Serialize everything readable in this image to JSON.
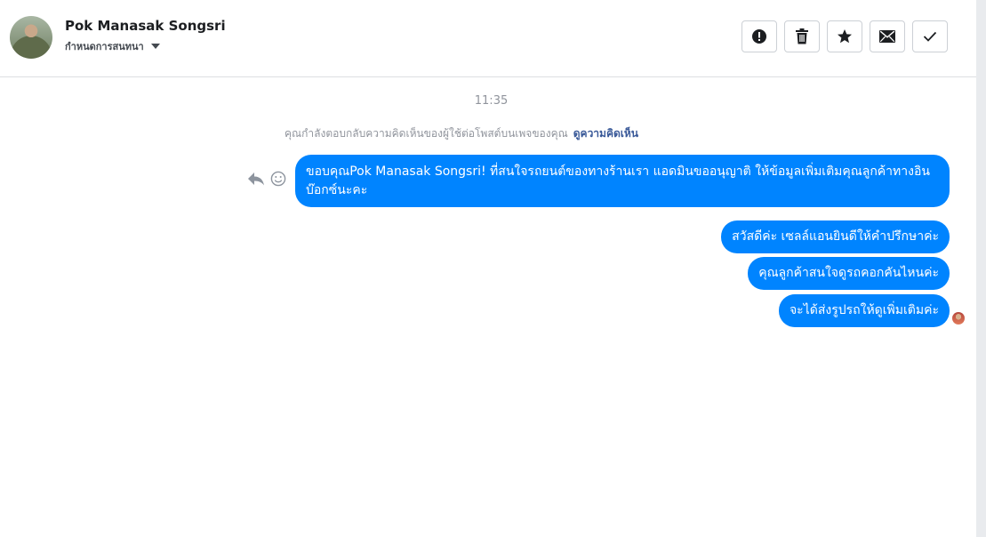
{
  "header": {
    "contact_name": "Pok Manasak Songsri",
    "assign_label": "กำหนดการสนทนา",
    "avatar_icon": "user-avatar",
    "toolbar": [
      {
        "name": "mark-spam-button",
        "icon": "exclamation-icon"
      },
      {
        "name": "delete-button",
        "icon": "trash-icon"
      },
      {
        "name": "star-button",
        "icon": "star-icon"
      },
      {
        "name": "mark-unread-button",
        "icon": "envelope-icon"
      },
      {
        "name": "mark-done-button",
        "icon": "checkmark-icon"
      }
    ]
  },
  "conversation": {
    "timestamp": "11:35",
    "context_text": "คุณกำลังตอบกลับความคิดเห็นของผู้ใช้ต่อโพสต์บนเพจของคุณ",
    "context_link": "ดูความคิดเห็น",
    "messages": [
      {
        "text": "ขอบคุณPok Manasak Songsri! ที่สนใจรถยนต์ของทางร้านเรา แอดมินขออนุญาติ ให้ข้อมูลเพิ่มเติมคุณลูกค้าทางอินบ๊อกซ์นะคะ"
      },
      {
        "text": "สวัสดีค่ะ เซลล์แอนยินดีให้คำปรึกษาค่ะ"
      },
      {
        "text": "คุณลูกค้าสนใจดูรถคอกคันไหนค่ะ"
      },
      {
        "text": "จะได้ส่งรูปรถให้ดูเพิ่มเติมค่ะ"
      }
    ]
  },
  "colors": {
    "bubble": "#0084ff",
    "link": "#385898",
    "muted": "#90949c"
  }
}
